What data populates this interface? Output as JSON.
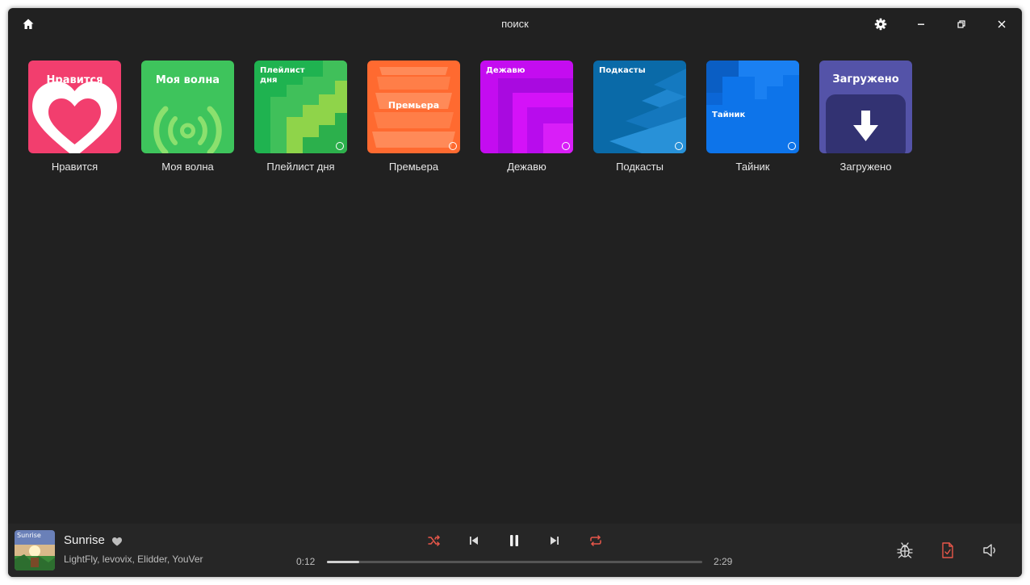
{
  "window": {
    "title": "поиск"
  },
  "titlebar": {
    "home_icon": "home-icon",
    "settings_icon": "gear-icon",
    "minimize_icon": "minimize-icon",
    "restore_icon": "restore-icon",
    "close_icon": "close-icon"
  },
  "tiles": [
    {
      "caption": "Нравится",
      "cover_text": "Нравится",
      "color": "#f23e6e"
    },
    {
      "caption": "Моя волна",
      "cover_text": "Моя волна",
      "color": "#3ec45c"
    },
    {
      "caption": "Плейлист дня",
      "cover_text": "Плейлист\nдня",
      "color": "#1fb350"
    },
    {
      "caption": "Премьера",
      "cover_text": "Премьера",
      "color": "#ff6a30"
    },
    {
      "caption": "Дежавю",
      "cover_text": "Дежавю",
      "color": "#c40cf0"
    },
    {
      "caption": "Подкасты",
      "cover_text": "Подкасты",
      "color": "#0a6aa8"
    },
    {
      "caption": "Тайник",
      "cover_text": "Тайник",
      "color": "#0d74ea"
    },
    {
      "caption": "Загружено",
      "cover_text": "Загружено",
      "color": "#5453a8"
    }
  ],
  "player": {
    "title": "Sunrise",
    "artists": "LightFly, levovix, Elidder, YouVer",
    "art_text": "Sunrise",
    "current_time": "0:12",
    "total_time": "2:29",
    "progress": 0.085,
    "accent": "#e8574a",
    "icons": {
      "like": "heart-icon",
      "shuffle": "shuffle-icon",
      "previous": "skip-previous-icon",
      "pause": "pause-icon",
      "next": "skip-next-icon",
      "repeat": "repeat-icon",
      "debug": "bug-icon",
      "file": "file-check-icon",
      "volume": "volume-icon"
    }
  }
}
